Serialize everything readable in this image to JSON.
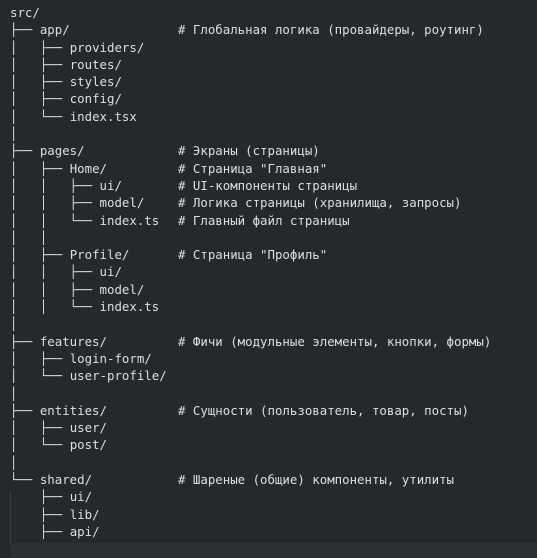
{
  "lines": [
    {
      "prefix": "",
      "name": "src/",
      "comment": ""
    },
    {
      "prefix": "├── ",
      "name": "app/",
      "comment": "# Глобальная логика (провайдеры, роутинг)"
    },
    {
      "prefix": "│   ├── ",
      "name": "providers/",
      "comment": ""
    },
    {
      "prefix": "│   ├── ",
      "name": "routes/",
      "comment": ""
    },
    {
      "prefix": "│   ├── ",
      "name": "styles/",
      "comment": ""
    },
    {
      "prefix": "│   ├── ",
      "name": "config/",
      "comment": ""
    },
    {
      "prefix": "│   └── ",
      "name": "index.tsx",
      "comment": ""
    },
    {
      "prefix": "│",
      "name": "",
      "comment": ""
    },
    {
      "prefix": "├── ",
      "name": "pages/",
      "comment": "# Экраны (страницы)"
    },
    {
      "prefix": "│   ├── ",
      "name": "Home/",
      "comment": "# Страница \"Главная\""
    },
    {
      "prefix": "│   │   ├── ",
      "name": "ui/",
      "comment": "# UI-компоненты страницы"
    },
    {
      "prefix": "│   │   ├── ",
      "name": "model/",
      "comment": "# Логика страницы (хранилища, запросы)"
    },
    {
      "prefix": "│   │   └── ",
      "name": "index.ts",
      "comment": "# Главный файл страницы"
    },
    {
      "prefix": "│   │",
      "name": "",
      "comment": ""
    },
    {
      "prefix": "│   ├── ",
      "name": "Profile/",
      "comment": "# Страница \"Профиль\""
    },
    {
      "prefix": "│   │   ├── ",
      "name": "ui/",
      "comment": ""
    },
    {
      "prefix": "│   │   ├── ",
      "name": "model/",
      "comment": ""
    },
    {
      "prefix": "│   │   └── ",
      "name": "index.ts",
      "comment": ""
    },
    {
      "prefix": "│",
      "name": "",
      "comment": ""
    },
    {
      "prefix": "├── ",
      "name": "features/",
      "comment": "# Фичи (модульные элементы, кнопки, формы)"
    },
    {
      "prefix": "│   ├── ",
      "name": "login-form/",
      "comment": ""
    },
    {
      "prefix": "│   └── ",
      "name": "user-profile/",
      "comment": ""
    },
    {
      "prefix": "│",
      "name": "",
      "comment": ""
    },
    {
      "prefix": "├── ",
      "name": "entities/",
      "comment": "# Сущности (пользователь, товар, посты)"
    },
    {
      "prefix": "│   ├── ",
      "name": "user/",
      "comment": ""
    },
    {
      "prefix": "│   └── ",
      "name": "post/",
      "comment": ""
    },
    {
      "prefix": "│",
      "name": "",
      "comment": ""
    },
    {
      "prefix": "└── ",
      "name": "shared/",
      "comment": "# Шареные (общие) компоненты, утилиты"
    },
    {
      "prefix": "    ├── ",
      "name": "ui/",
      "comment": ""
    },
    {
      "prefix": "    ├── ",
      "name": "lib/",
      "comment": ""
    },
    {
      "prefix": "    ├── ",
      "name": "api/",
      "comment": ""
    }
  ]
}
